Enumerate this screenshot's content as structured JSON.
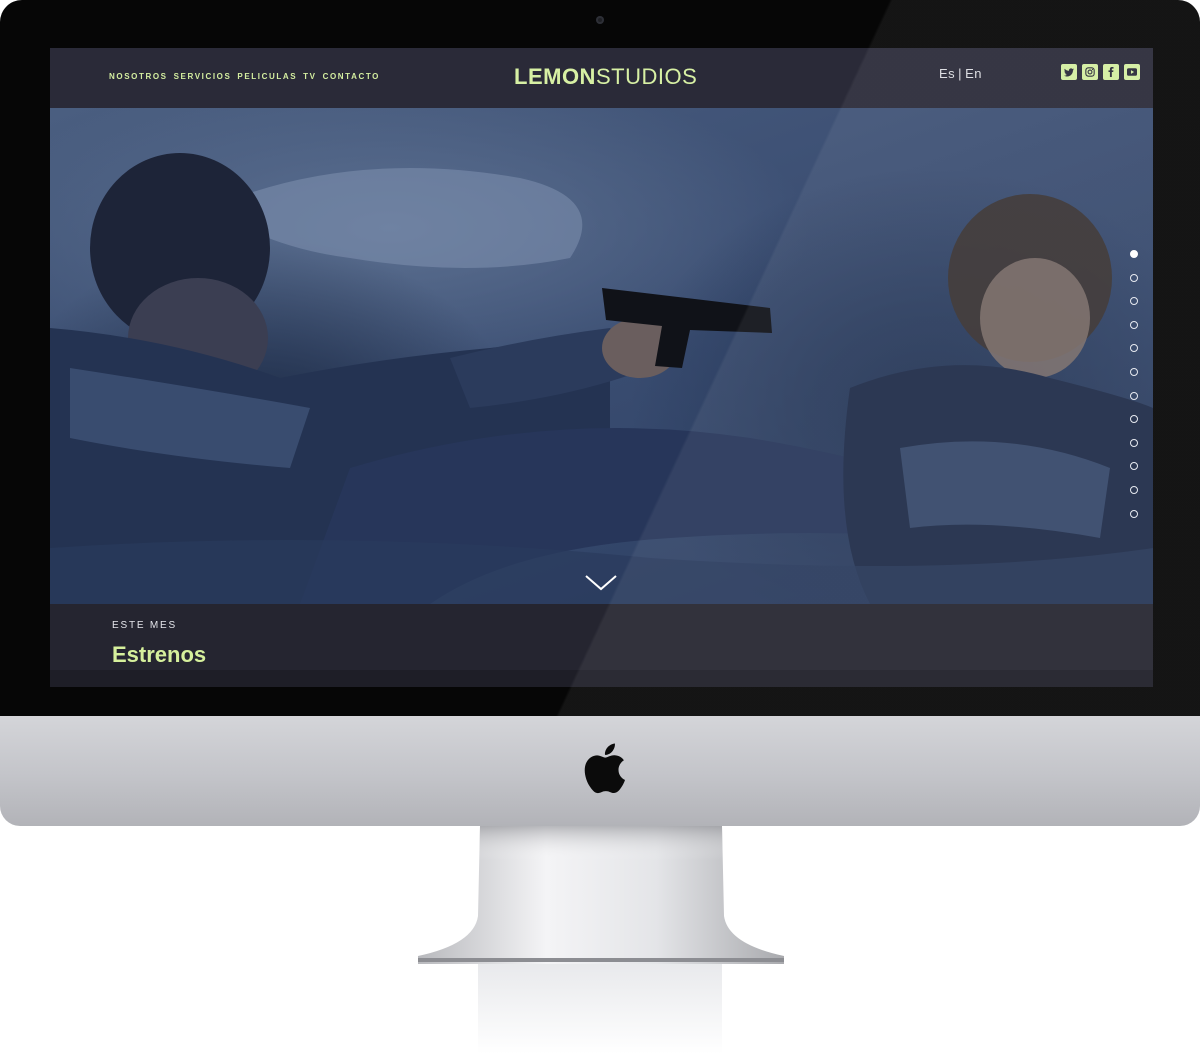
{
  "nav": {
    "items": [
      {
        "label": "NOSOTROS"
      },
      {
        "label": "SERVICIOS"
      },
      {
        "label": "PELICULAS"
      },
      {
        "label": "TV"
      },
      {
        "label": "CONTACTO"
      }
    ]
  },
  "logo": {
    "bold": "LEMON",
    "light": "STUDIOS"
  },
  "lang": {
    "es": "Es",
    "sep": "|",
    "en": "En"
  },
  "social": {
    "icons": [
      "twitter-icon",
      "instagram-icon",
      "facebook-icon",
      "youtube-icon"
    ]
  },
  "hero": {
    "slides_total": 12,
    "active_slide": 1,
    "scroll_icon": "chevron-down-icon"
  },
  "section": {
    "kicker": "ESTE MES",
    "title": "Estrenos"
  },
  "colors": {
    "accent": "#d4eea0",
    "topbar": "#2a2a38",
    "page": "#25252f",
    "hero": "#3d5074"
  }
}
